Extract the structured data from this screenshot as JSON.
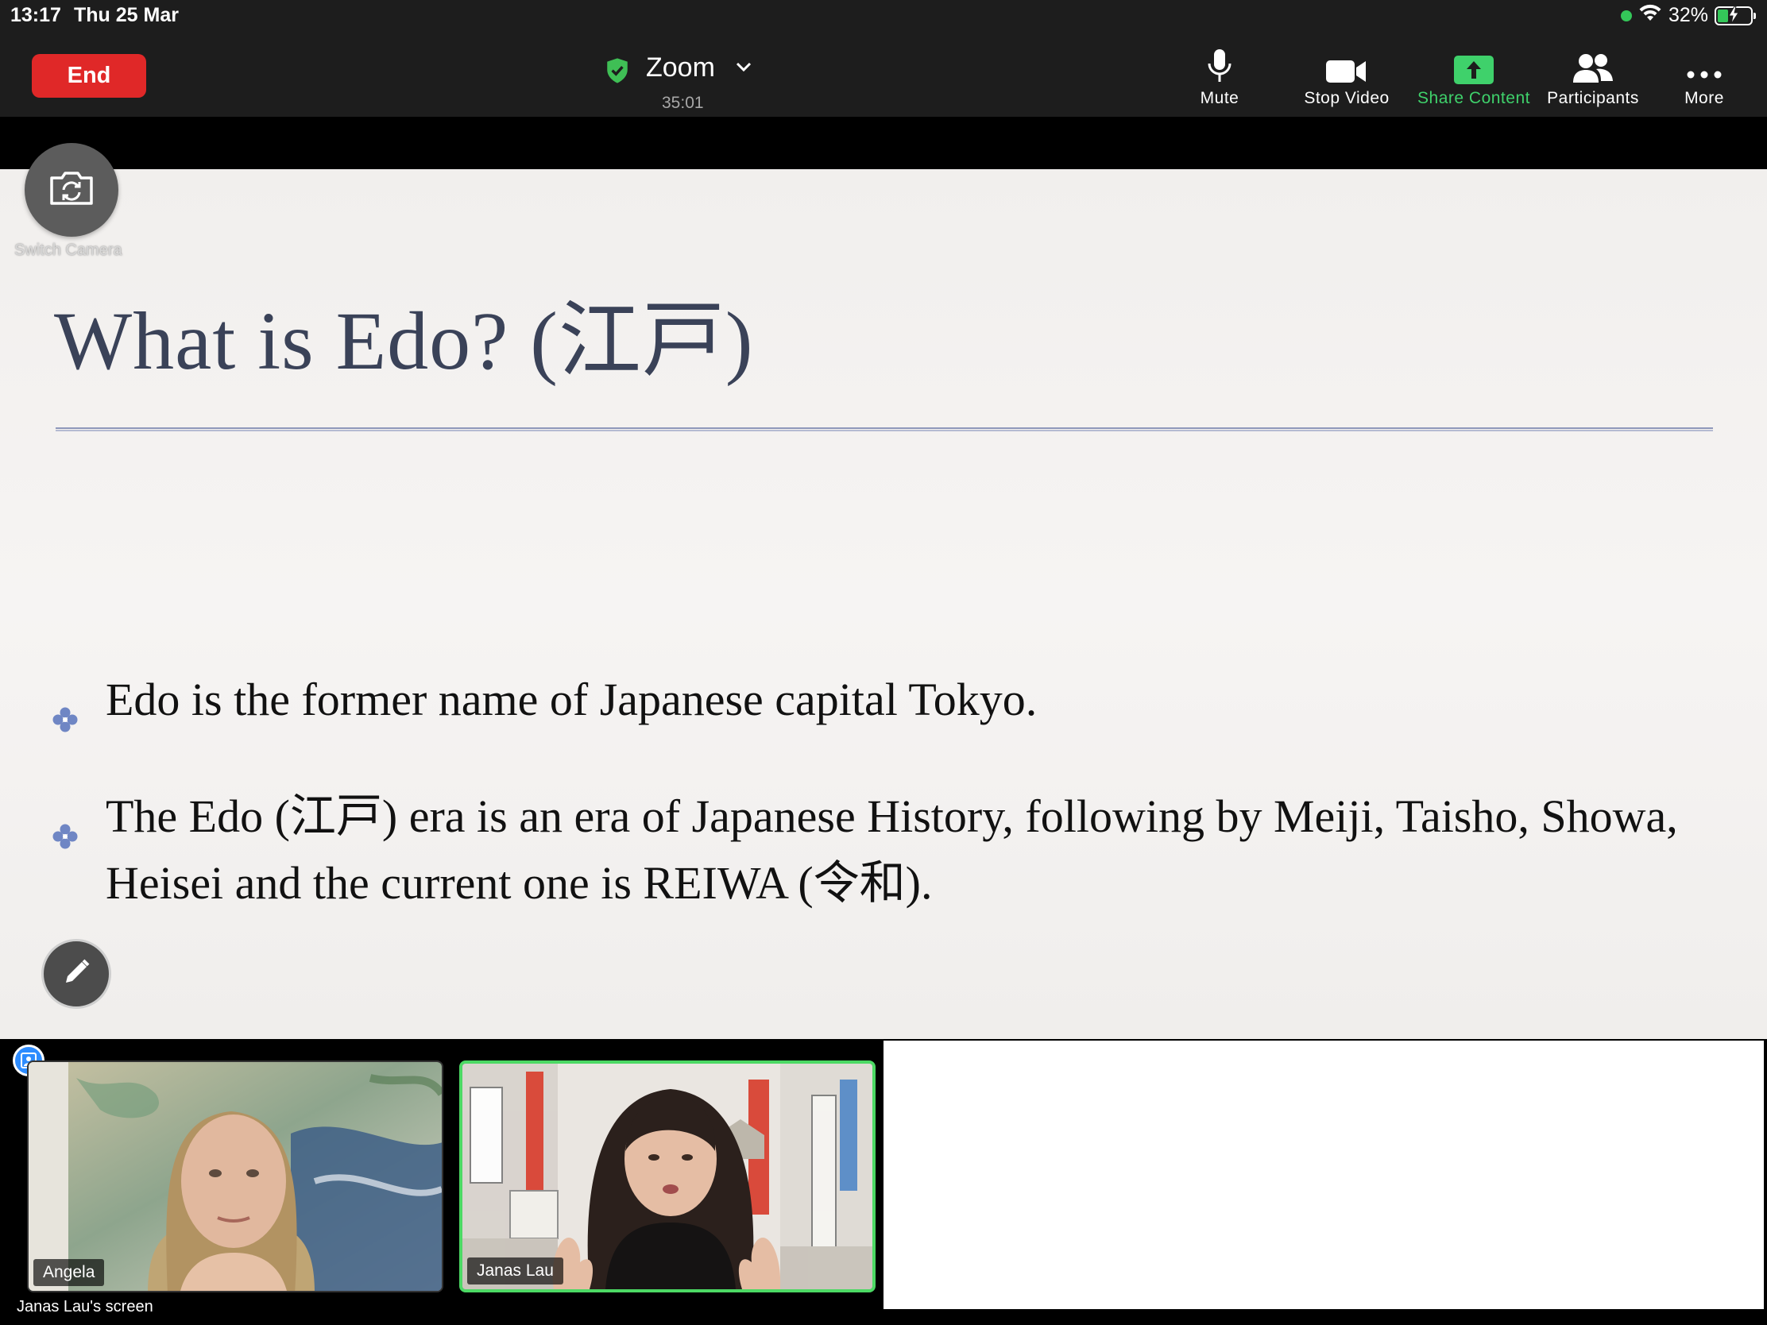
{
  "status": {
    "time": "13:17",
    "date": "Thu 25 Mar",
    "battery_percent": "32%",
    "battery_level": 0.32,
    "colors": {
      "battery": "#34c759",
      "dot": "#34c759"
    }
  },
  "toolbar": {
    "end_label": "End",
    "meeting_title": "Zoom",
    "meeting_timer": "35:01",
    "tools": {
      "mute": "Mute",
      "stop_video": "Stop Video",
      "share_content": "Share Content",
      "participants": "Participants",
      "more": "More"
    },
    "colors": {
      "end": "#e02828",
      "share": "#3fd16b"
    }
  },
  "slide": {
    "title": "What is Edo? (江戸)",
    "bullets": [
      "Edo is the former name of Japanese capital Tokyo.",
      "The Edo (江戸) era is an era of Japanese History, following by Meiji, Taisho, Showa, Heisei and the current one is REIWA (令和)."
    ],
    "colors": {
      "title": "#3a4258",
      "bullet_mark": "#6f86c4"
    }
  },
  "controls": {
    "switch_camera_label": "Switch Camera"
  },
  "participants": [
    {
      "name": "Angela",
      "active_speaker": false
    },
    {
      "name": "Janas Lau",
      "active_speaker": true
    }
  ],
  "screen_label": "Janas Lau's screen"
}
